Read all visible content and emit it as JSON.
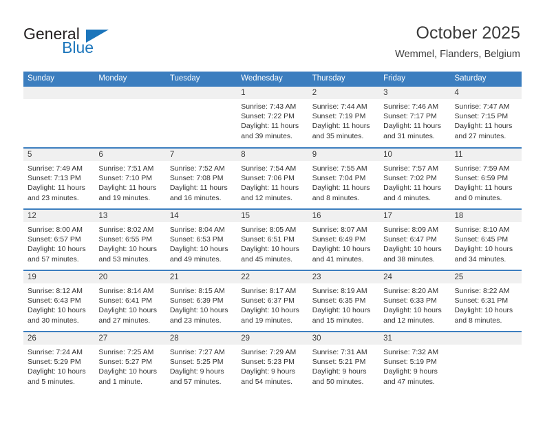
{
  "brand": {
    "name_part1": "General",
    "name_part2": "Blue",
    "triangle_icon": "triangle-icon",
    "accent_color": "#1b75bb"
  },
  "header": {
    "title": "October 2025",
    "subtitle": "Wemmel, Flanders, Belgium"
  },
  "theme": {
    "header_blue": "#3c7ebf",
    "daynum_bg": "#f0f0f0",
    "text": "#333333"
  },
  "calendar": {
    "weekday_headers": [
      "Sunday",
      "Monday",
      "Tuesday",
      "Wednesday",
      "Thursday",
      "Friday",
      "Saturday"
    ],
    "weeks": [
      [
        {
          "day": "",
          "lines": []
        },
        {
          "day": "",
          "lines": []
        },
        {
          "day": "",
          "lines": []
        },
        {
          "day": "1",
          "lines": [
            "Sunrise: 7:43 AM",
            "Sunset: 7:22 PM",
            "Daylight: 11 hours",
            "and 39 minutes."
          ]
        },
        {
          "day": "2",
          "lines": [
            "Sunrise: 7:44 AM",
            "Sunset: 7:19 PM",
            "Daylight: 11 hours",
            "and 35 minutes."
          ]
        },
        {
          "day": "3",
          "lines": [
            "Sunrise: 7:46 AM",
            "Sunset: 7:17 PM",
            "Daylight: 11 hours",
            "and 31 minutes."
          ]
        },
        {
          "day": "4",
          "lines": [
            "Sunrise: 7:47 AM",
            "Sunset: 7:15 PM",
            "Daylight: 11 hours",
            "and 27 minutes."
          ]
        }
      ],
      [
        {
          "day": "5",
          "lines": [
            "Sunrise: 7:49 AM",
            "Sunset: 7:13 PM",
            "Daylight: 11 hours",
            "and 23 minutes."
          ]
        },
        {
          "day": "6",
          "lines": [
            "Sunrise: 7:51 AM",
            "Sunset: 7:10 PM",
            "Daylight: 11 hours",
            "and 19 minutes."
          ]
        },
        {
          "day": "7",
          "lines": [
            "Sunrise: 7:52 AM",
            "Sunset: 7:08 PM",
            "Daylight: 11 hours",
            "and 16 minutes."
          ]
        },
        {
          "day": "8",
          "lines": [
            "Sunrise: 7:54 AM",
            "Sunset: 7:06 PM",
            "Daylight: 11 hours",
            "and 12 minutes."
          ]
        },
        {
          "day": "9",
          "lines": [
            "Sunrise: 7:55 AM",
            "Sunset: 7:04 PM",
            "Daylight: 11 hours",
            "and 8 minutes."
          ]
        },
        {
          "day": "10",
          "lines": [
            "Sunrise: 7:57 AM",
            "Sunset: 7:02 PM",
            "Daylight: 11 hours",
            "and 4 minutes."
          ]
        },
        {
          "day": "11",
          "lines": [
            "Sunrise: 7:59 AM",
            "Sunset: 6:59 PM",
            "Daylight: 11 hours",
            "and 0 minutes."
          ]
        }
      ],
      [
        {
          "day": "12",
          "lines": [
            "Sunrise: 8:00 AM",
            "Sunset: 6:57 PM",
            "Daylight: 10 hours",
            "and 57 minutes."
          ]
        },
        {
          "day": "13",
          "lines": [
            "Sunrise: 8:02 AM",
            "Sunset: 6:55 PM",
            "Daylight: 10 hours",
            "and 53 minutes."
          ]
        },
        {
          "day": "14",
          "lines": [
            "Sunrise: 8:04 AM",
            "Sunset: 6:53 PM",
            "Daylight: 10 hours",
            "and 49 minutes."
          ]
        },
        {
          "day": "15",
          "lines": [
            "Sunrise: 8:05 AM",
            "Sunset: 6:51 PM",
            "Daylight: 10 hours",
            "and 45 minutes."
          ]
        },
        {
          "day": "16",
          "lines": [
            "Sunrise: 8:07 AM",
            "Sunset: 6:49 PM",
            "Daylight: 10 hours",
            "and 41 minutes."
          ]
        },
        {
          "day": "17",
          "lines": [
            "Sunrise: 8:09 AM",
            "Sunset: 6:47 PM",
            "Daylight: 10 hours",
            "and 38 minutes."
          ]
        },
        {
          "day": "18",
          "lines": [
            "Sunrise: 8:10 AM",
            "Sunset: 6:45 PM",
            "Daylight: 10 hours",
            "and 34 minutes."
          ]
        }
      ],
      [
        {
          "day": "19",
          "lines": [
            "Sunrise: 8:12 AM",
            "Sunset: 6:43 PM",
            "Daylight: 10 hours",
            "and 30 minutes."
          ]
        },
        {
          "day": "20",
          "lines": [
            "Sunrise: 8:14 AM",
            "Sunset: 6:41 PM",
            "Daylight: 10 hours",
            "and 27 minutes."
          ]
        },
        {
          "day": "21",
          "lines": [
            "Sunrise: 8:15 AM",
            "Sunset: 6:39 PM",
            "Daylight: 10 hours",
            "and 23 minutes."
          ]
        },
        {
          "day": "22",
          "lines": [
            "Sunrise: 8:17 AM",
            "Sunset: 6:37 PM",
            "Daylight: 10 hours",
            "and 19 minutes."
          ]
        },
        {
          "day": "23",
          "lines": [
            "Sunrise: 8:19 AM",
            "Sunset: 6:35 PM",
            "Daylight: 10 hours",
            "and 15 minutes."
          ]
        },
        {
          "day": "24",
          "lines": [
            "Sunrise: 8:20 AM",
            "Sunset: 6:33 PM",
            "Daylight: 10 hours",
            "and 12 minutes."
          ]
        },
        {
          "day": "25",
          "lines": [
            "Sunrise: 8:22 AM",
            "Sunset: 6:31 PM",
            "Daylight: 10 hours",
            "and 8 minutes."
          ]
        }
      ],
      [
        {
          "day": "26",
          "lines": [
            "Sunrise: 7:24 AM",
            "Sunset: 5:29 PM",
            "Daylight: 10 hours",
            "and 5 minutes."
          ]
        },
        {
          "day": "27",
          "lines": [
            "Sunrise: 7:25 AM",
            "Sunset: 5:27 PM",
            "Daylight: 10 hours",
            "and 1 minute."
          ]
        },
        {
          "day": "28",
          "lines": [
            "Sunrise: 7:27 AM",
            "Sunset: 5:25 PM",
            "Daylight: 9 hours",
            "and 57 minutes."
          ]
        },
        {
          "day": "29",
          "lines": [
            "Sunrise: 7:29 AM",
            "Sunset: 5:23 PM",
            "Daylight: 9 hours",
            "and 54 minutes."
          ]
        },
        {
          "day": "30",
          "lines": [
            "Sunrise: 7:31 AM",
            "Sunset: 5:21 PM",
            "Daylight: 9 hours",
            "and 50 minutes."
          ]
        },
        {
          "day": "31",
          "lines": [
            "Sunrise: 7:32 AM",
            "Sunset: 5:19 PM",
            "Daylight: 9 hours",
            "and 47 minutes."
          ]
        },
        {
          "day": "",
          "lines": []
        }
      ]
    ]
  }
}
